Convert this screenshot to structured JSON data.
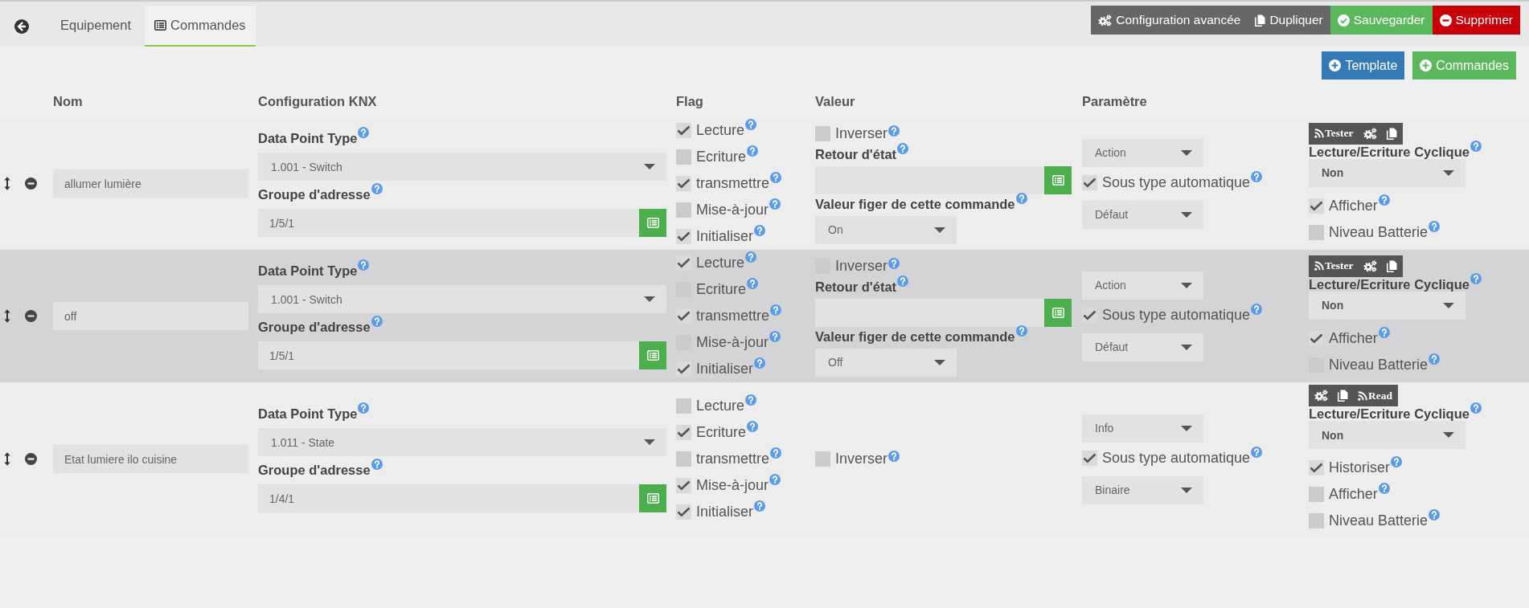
{
  "header": {
    "tabs": [
      {
        "label": "Equipement",
        "selected": false,
        "has_icon": false
      },
      {
        "label": "Commandes",
        "selected": true,
        "has_icon": true
      }
    ],
    "actions": [
      {
        "kind": "configure",
        "label": "Configuration avancée"
      },
      {
        "kind": "duplicate",
        "label": "Dupliquer"
      },
      {
        "kind": "save",
        "label": "Sauvegarder"
      },
      {
        "kind": "delete",
        "label": "Supprimer"
      }
    ]
  },
  "toolbar": {
    "buttons": [
      {
        "kind": "template",
        "label": "Template"
      },
      {
        "kind": "add",
        "label": "Commandes"
      }
    ]
  },
  "table": {
    "columns": [
      "Nom",
      "Configuration KNX",
      "Flag",
      "Valeur",
      "Paramètre"
    ],
    "rows": [
      {
        "highlighted": false,
        "name": "allumer lumière",
        "knx": {
          "dpt_label": "Data Point Type",
          "dpt": "1.001 - Switch",
          "address_label": "Groupe d'adresse",
          "address": "1/5/1"
        },
        "flags": [
          {
            "label": "Lecture",
            "checked": true
          },
          {
            "label": "Ecriture",
            "checked": false
          },
          {
            "label": "transmettre",
            "checked": true
          },
          {
            "label": "Mise-à-jour",
            "checked": false
          },
          {
            "label": "Initialiser",
            "checked": true
          }
        ],
        "value": {
          "invert": {
            "label": "Inverser",
            "checked": false
          },
          "state_return_label": "Retour d'état",
          "freeze_label": "Valeur figer de cette commande",
          "freeze": "On"
        },
        "parameter": {
          "type": "Action",
          "auto_subtype": {
            "label": "Sous type automatique",
            "checked": true
          },
          "subtype": "Défaut"
        },
        "test_button": {
          "label": "Tester"
        },
        "tool_buttons": [
          {
            "kind": "configure"
          },
          {
            "kind": "copy"
          }
        ],
        "cyclic_label": "Lecture/Ecriture Cyclique",
        "cyclic": "Non",
        "options": [
          {
            "label": "Afficher",
            "checked": true
          },
          {
            "label": "Niveau Batterie",
            "checked": false
          }
        ]
      },
      {
        "highlighted": true,
        "name": "off",
        "knx": {
          "dpt_label": "Data Point Type",
          "dpt": "1.001 - Switch",
          "address_label": "Groupe d'adresse",
          "address": "1/5/1"
        },
        "flags": [
          {
            "label": "Lecture",
            "checked": true
          },
          {
            "label": "Ecriture",
            "checked": false
          },
          {
            "label": "transmettre",
            "checked": true
          },
          {
            "label": "Mise-à-jour",
            "checked": false
          },
          {
            "label": "Initialiser",
            "checked": true
          }
        ],
        "value": {
          "invert": {
            "label": "Inverser",
            "checked": false
          },
          "state_return_label": "Retour d'état",
          "freeze_label": "Valeur figer de cette commande",
          "freeze": "Off"
        },
        "parameter": {
          "type": "Action",
          "auto_subtype": {
            "label": "Sous type automatique",
            "checked": true
          },
          "subtype": "Défaut"
        },
        "test_button": {
          "label": "Tester"
        },
        "tool_buttons": [
          {
            "kind": "configure"
          },
          {
            "kind": "copy"
          }
        ],
        "cyclic_label": "Lecture/Ecriture Cyclique",
        "cyclic": "Non",
        "options": [
          {
            "label": "Afficher",
            "checked": true
          },
          {
            "label": "Niveau Batterie",
            "checked": false
          }
        ]
      },
      {
        "highlighted": false,
        "name": "Etat lumiere ilo cuisine",
        "knx": {
          "dpt_label": "Data Point Type",
          "dpt": "1.011 - State",
          "address_label": "Groupe d'adresse",
          "address": "1/4/1"
        },
        "flags": [
          {
            "label": "Lecture",
            "checked": false
          },
          {
            "label": "Ecriture",
            "checked": true
          },
          {
            "label": "transmettre",
            "checked": false
          },
          {
            "label": "Mise-à-jour",
            "checked": true
          },
          {
            "label": "Initialiser",
            "checked": true
          }
        ],
        "value": {
          "invert": {
            "label": "Inverser",
            "checked": false
          }
        },
        "parameter": {
          "type": "Info",
          "auto_subtype": {
            "label": "Sous type automatique",
            "checked": true
          },
          "subtype": "Binaire"
        },
        "tool_buttons": [
          {
            "kind": "configure"
          },
          {
            "kind": "copy"
          }
        ],
        "read_button": {
          "label": "Read"
        },
        "cyclic_label": "Lecture/Ecriture Cyclique",
        "cyclic": "Non",
        "options": [
          {
            "label": "Historiser",
            "checked": true
          },
          {
            "label": "Afficher",
            "checked": false
          },
          {
            "label": "Niveau Batterie",
            "checked": false
          }
        ]
      }
    ]
  }
}
